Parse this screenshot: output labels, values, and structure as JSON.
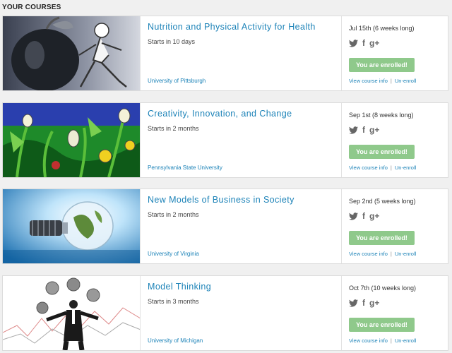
{
  "section_title": "YOUR COURSES",
  "courses": [
    {
      "title": "Nutrition and Physical Activity for Health",
      "starts": "Starts in 10 days",
      "university": "University of Pittsburgh",
      "date": "Jul 15th (6 weeks long)",
      "enrolled_label": "You are enrolled!",
      "view_info": "View course info",
      "unenroll": "Un-enroll",
      "image": "apple-and-runner-sketch"
    },
    {
      "title": "Creativity, Innovation, and Change",
      "starts": "Starts in 2 months",
      "university": "Pennsylvania State University",
      "date": "Sep 1st (8 weeks long)",
      "enrolled_label": "You are enrolled!",
      "view_info": "View course info",
      "unenroll": "Un-enroll",
      "image": "lightbulb-plants-illustration"
    },
    {
      "title": "New Models of Business in Society",
      "starts": "Starts in 2 months",
      "university": "University of Virginia",
      "date": "Sep 2nd (5 weeks long)",
      "enrolled_label": "You are enrolled!",
      "view_info": "View course info",
      "unenroll": "Un-enroll",
      "image": "globe-lightbulb-photo"
    },
    {
      "title": "Model Thinking",
      "starts": "Starts in 3 months",
      "university": "University of Michigan",
      "date": "Oct 7th (10 weeks long)",
      "enrolled_label": "You are enrolled!",
      "view_info": "View course info",
      "unenroll": "Un-enroll",
      "image": "juggling-globes-businessman"
    }
  ],
  "social": {
    "google_plus": "g+",
    "facebook": "f"
  },
  "colors": {
    "link": "#1d83b8",
    "enrolled_bg": "#8fc98b",
    "page_bg": "#f0f0f0"
  }
}
